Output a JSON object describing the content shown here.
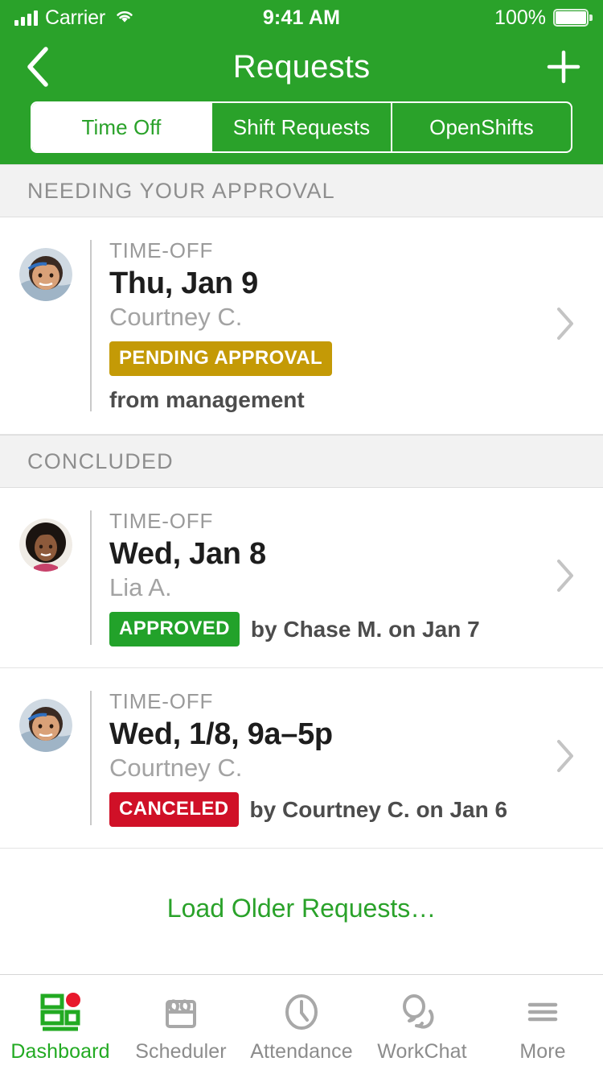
{
  "statusbar": {
    "carrier": "Carrier",
    "time": "9:41 AM",
    "battery_pct": "100%",
    "signal_icon": "signal-bars-icon",
    "wifi_icon": "wifi-icon",
    "battery_icon": "battery-full-icon"
  },
  "navbar": {
    "title": "Requests",
    "back_icon": "chevron-left-icon",
    "add_icon": "plus-icon"
  },
  "segmented": {
    "tabs": [
      {
        "label": "Time Off",
        "active": true
      },
      {
        "label": "Shift Requests",
        "active": false
      },
      {
        "label": "OpenShifts",
        "active": false
      }
    ]
  },
  "colors": {
    "brand_green": "#2aa22a",
    "approved_green": "#22a22a",
    "pending_gold": "#c49a06",
    "canceled_red": "#d01027",
    "section_bg": "#f2f2f2",
    "notification_dot": "#e8192c"
  },
  "sections": [
    {
      "title": "NEEDING YOUR APPROVAL",
      "requests": [
        {
          "kind": "TIME-OFF",
          "date": "Thu, Jan 9",
          "person": "Courtney C.",
          "badge": "PENDING APPROVAL",
          "badge_color": "#c49a06",
          "note": "from management",
          "avatar": "avatar-courtney",
          "chevron_icon": "chevron-right-icon"
        }
      ]
    },
    {
      "title": "CONCLUDED",
      "requests": [
        {
          "kind": "TIME-OFF",
          "date": "Wed, Jan 8",
          "person": "Lia A.",
          "badge": "APPROVED",
          "badge_color": "#22a22a",
          "note": "by Chase M. on Jan 7",
          "avatar": "avatar-lia",
          "chevron_icon": "chevron-right-icon"
        },
        {
          "kind": "TIME-OFF",
          "date": "Wed, 1/8, 9a–5p",
          "person": "Courtney C.",
          "badge": "CANCELED",
          "badge_color": "#d01027",
          "note": "by Courtney C. on Jan 6",
          "avatar": "avatar-courtney",
          "chevron_icon": "chevron-right-icon"
        }
      ]
    }
  ],
  "load_more_label": "Load Older Requests…",
  "tabbar": {
    "items": [
      {
        "label": "Dashboard",
        "icon": "dashboard-icon",
        "active": true,
        "badge_dot": true
      },
      {
        "label": "Scheduler",
        "icon": "calendar-icon",
        "active": false,
        "badge_dot": false
      },
      {
        "label": "Attendance",
        "icon": "clock-icon",
        "active": false,
        "badge_dot": false
      },
      {
        "label": "WorkChat",
        "icon": "chat-bubbles-icon",
        "active": false,
        "badge_dot": false
      },
      {
        "label": "More",
        "icon": "hamburger-icon",
        "active": false,
        "badge_dot": false
      }
    ]
  }
}
